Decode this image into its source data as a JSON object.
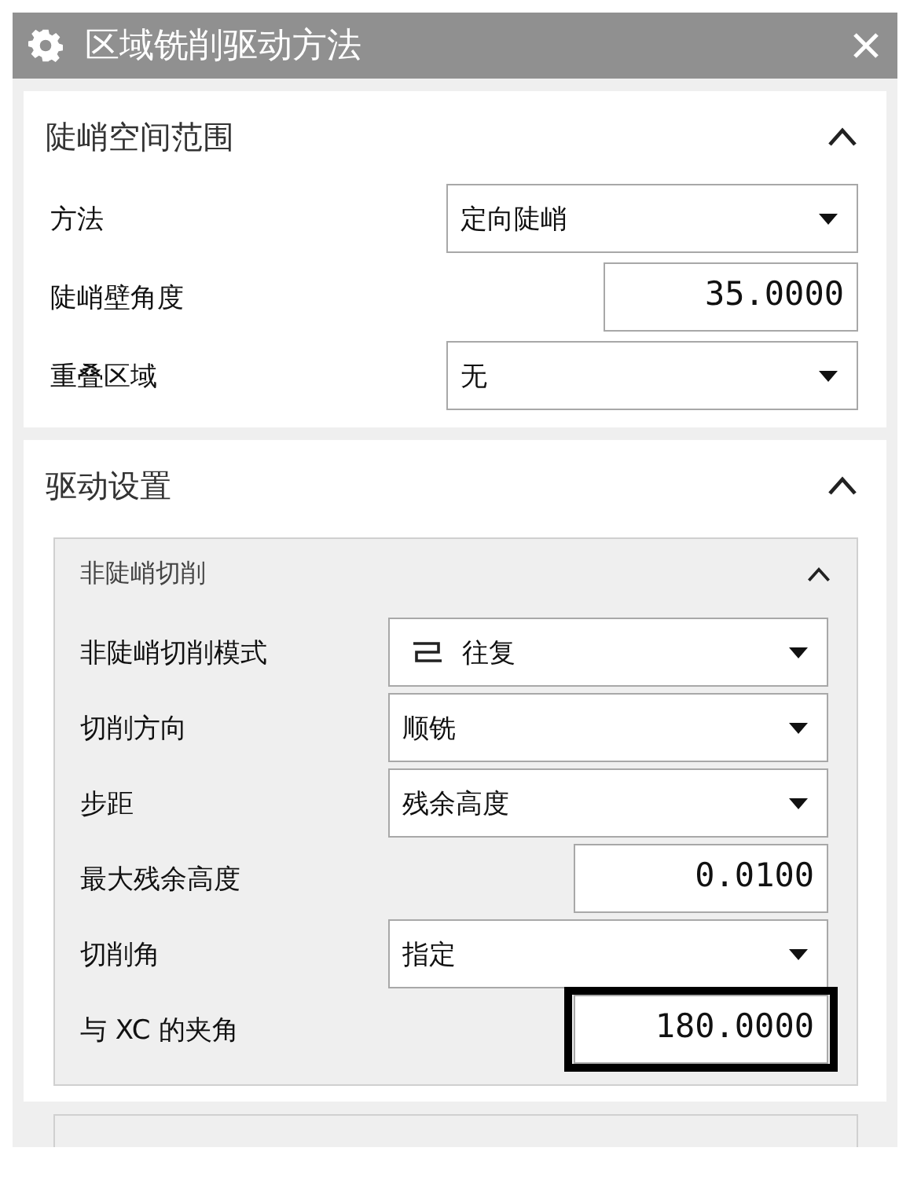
{
  "window": {
    "title": "区域铣削驱动方法"
  },
  "sections": [
    {
      "title": "陡峭空间范围",
      "expanded": true,
      "rows": [
        {
          "kind": "dropdown",
          "label": "方法",
          "value": "定向陡峭"
        },
        {
          "kind": "number",
          "label": "陡峭壁角度",
          "value": "35.0000"
        },
        {
          "kind": "dropdown",
          "label": "重叠区域",
          "value": "无"
        }
      ]
    },
    {
      "title": "驱动设置",
      "expanded": true,
      "subsections": [
        {
          "title": "非陡峭切削",
          "expanded": true,
          "rows": [
            {
              "kind": "pattern_dropdown",
              "label": "非陡峭切削模式",
              "value": "往复"
            },
            {
              "kind": "dropdown",
              "label": "切削方向",
              "value": "顺铣"
            },
            {
              "kind": "dropdown",
              "label": "步距",
              "value": "残余高度"
            },
            {
              "kind": "number",
              "label": "最大残余高度",
              "value": "0.0100"
            },
            {
              "kind": "dropdown",
              "label": "切削角",
              "value": "指定"
            },
            {
              "kind": "number",
              "label": "与 XC 的夹角",
              "value": "180.0000",
              "highlighted": true
            }
          ]
        }
      ]
    }
  ]
}
